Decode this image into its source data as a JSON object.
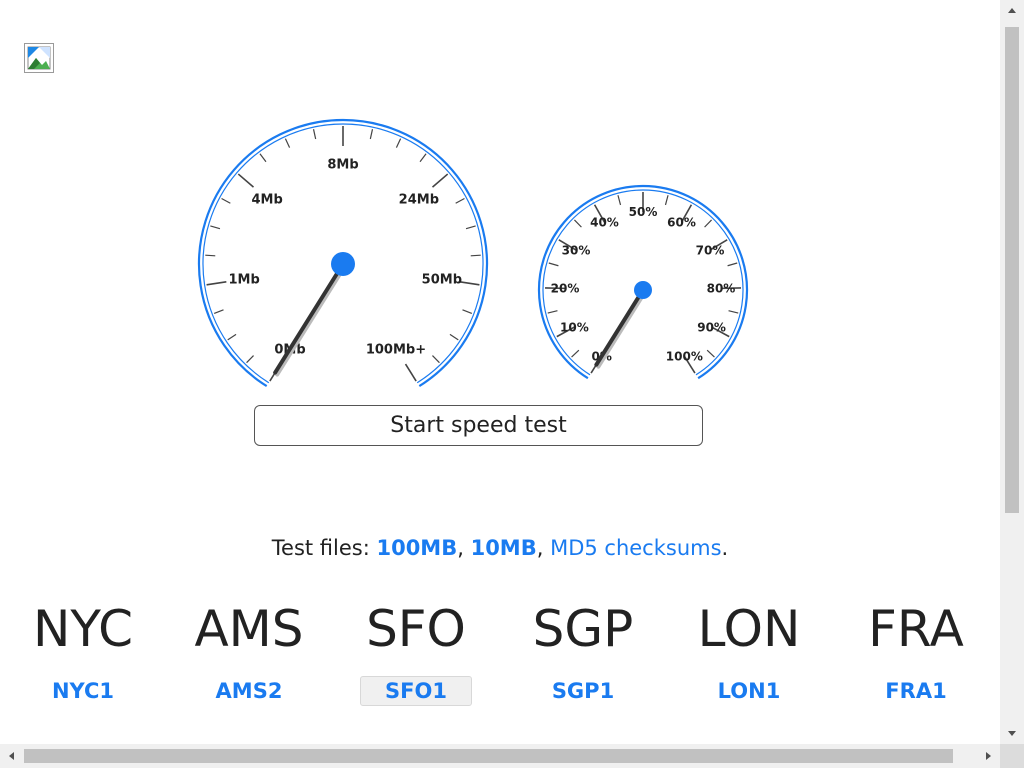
{
  "header": {
    "image_icon": "broken-image-icon"
  },
  "speed_gauge": {
    "labels": [
      "0Mb",
      "1Mb",
      "4Mb",
      "8Mb",
      "24Mb",
      "50Mb",
      "100Mb+"
    ],
    "needle_value_fraction": 0,
    "accent_color": "#1a7bf0"
  },
  "progress_gauge": {
    "labels": [
      "0%",
      "10%",
      "20%",
      "30%",
      "40%",
      "50%",
      "60%",
      "70%",
      "80%",
      "90%",
      "100%"
    ],
    "needle_value_fraction": 0,
    "accent_color": "#1a7bf0"
  },
  "start_button": {
    "label": "Start speed test"
  },
  "test_files": {
    "prefix": "Test files: ",
    "link_100mb": "100MB",
    "sep1": ", ",
    "link_10mb": "10MB",
    "sep2": ", ",
    "link_md5": "MD5 checksums",
    "suffix": "."
  },
  "regions": [
    {
      "code": "NYC",
      "datacenter": "NYC1",
      "selected": false
    },
    {
      "code": "AMS",
      "datacenter": "AMS2",
      "selected": false
    },
    {
      "code": "SFO",
      "datacenter": "SFO1",
      "selected": true
    },
    {
      "code": "SGP",
      "datacenter": "SGP1",
      "selected": false
    },
    {
      "code": "LON",
      "datacenter": "LON1",
      "selected": false
    },
    {
      "code": "FRA",
      "datacenter": "FRA1",
      "selected": false
    }
  ],
  "colors": {
    "link": "#1a7bf0",
    "text": "#222222"
  }
}
